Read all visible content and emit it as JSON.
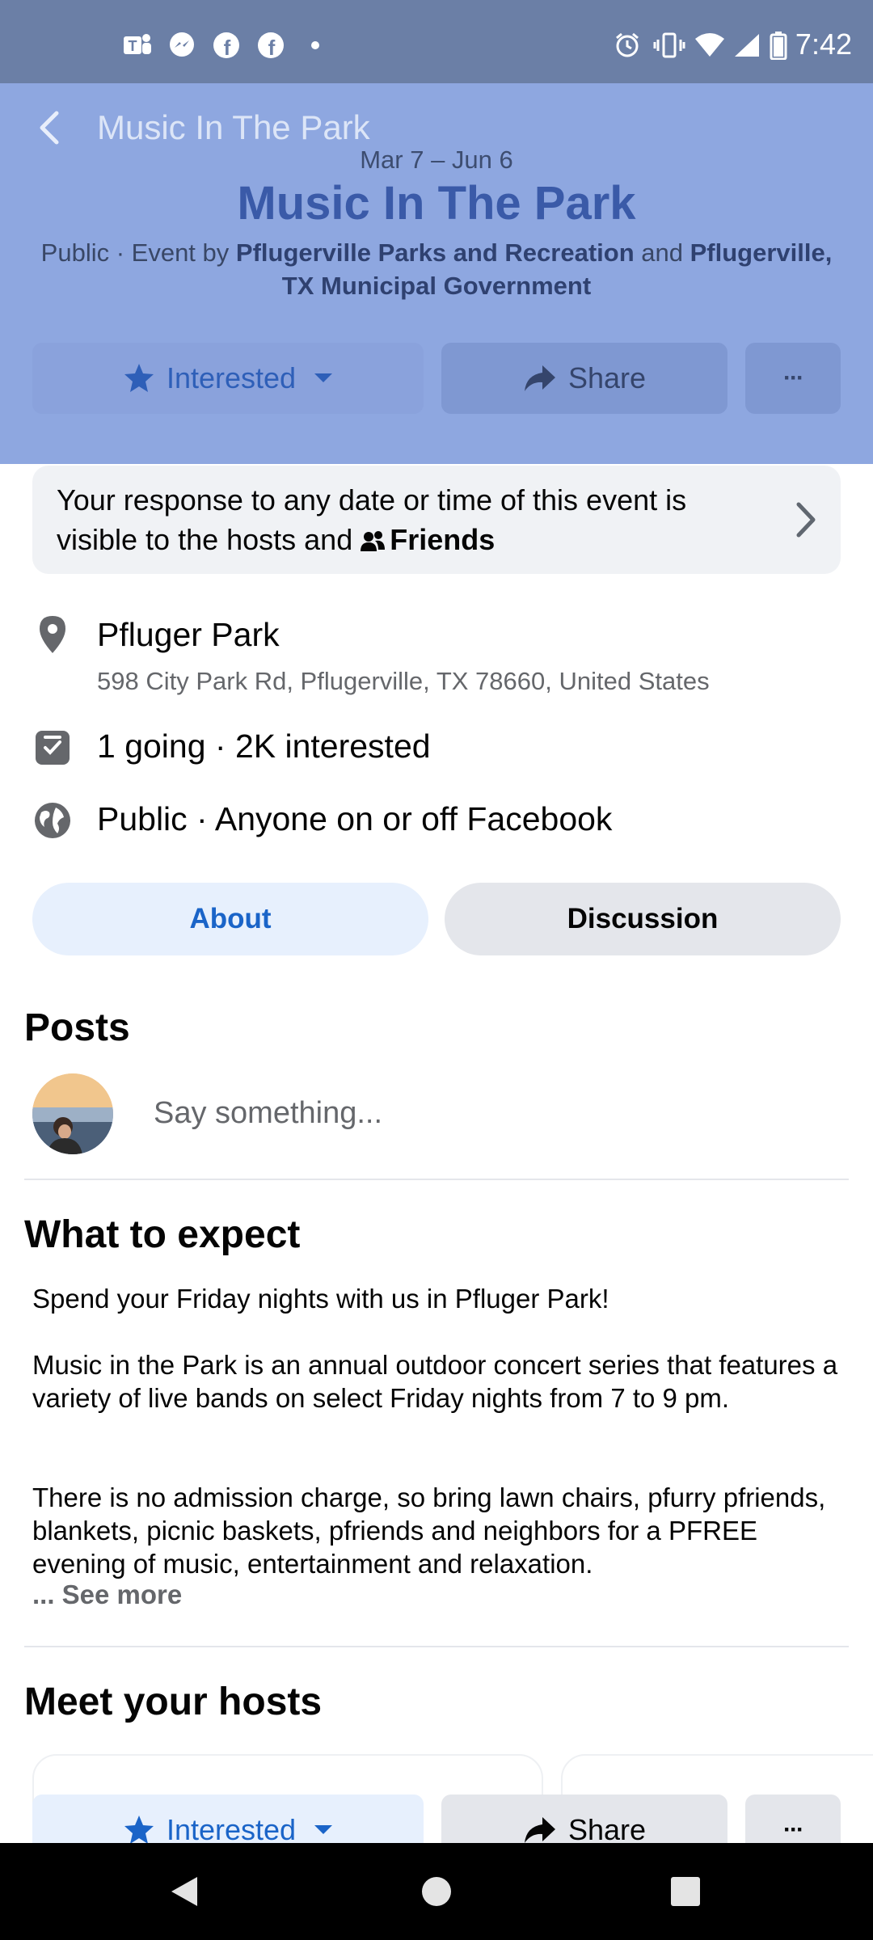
{
  "status_bar": {
    "time": "7:42",
    "left_icons": [
      "teams-icon",
      "messenger-icon",
      "facebook-icon",
      "facebook-icon",
      "dot-icon"
    ],
    "right_icons": [
      "alarm-icon",
      "vibrate-icon",
      "wifi-icon",
      "signal-icon",
      "battery-icon"
    ]
  },
  "nav": {
    "title": "Music In The Park"
  },
  "event": {
    "date_range": "Mar 7 – Jun 6",
    "title": "Music In The Park",
    "visibility": "Public · Event by ",
    "host1": "Pflugerville Parks and Recreation",
    "and_word": " and ",
    "host2": "Pflugerville, TX Municipal Government"
  },
  "actions": {
    "interested_label": "Interested",
    "share_label": "Share",
    "more_label": "···"
  },
  "notice": {
    "text": "Your response to any date or time of this event is visible to the hosts and ",
    "audience": "Friends"
  },
  "details": {
    "place_name": "Pfluger Park",
    "address": "598 City Park Rd, Pflugerville, TX 78660, United States",
    "attendance": "1 going · 2K interested",
    "privacy": "Public · Anyone on or off Facebook"
  },
  "tabs": {
    "about": "About",
    "discussion": "Discussion"
  },
  "posts": {
    "heading": "Posts",
    "placeholder": "Say something..."
  },
  "expect": {
    "heading": "What to expect",
    "para1": "Spend your Friday nights with us in Pfluger Park!",
    "para2": "Music in the Park is an annual outdoor concert series that features a variety of live bands on select Friday nights from 7 to 9 pm.",
    "para3": "There is no admission charge, so bring lawn chairs, pfurry pfriends, blankets, picnic baskets, pfriends and neighbors for a PFREE evening of music, entertainment and relaxation.",
    "see_more": "... See more"
  },
  "hosts": {
    "heading": "Meet your hosts"
  },
  "colors": {
    "accent_blue": "#1a64c8",
    "header_overlay": "#8ea7e0",
    "secondary_text": "#65676b"
  }
}
